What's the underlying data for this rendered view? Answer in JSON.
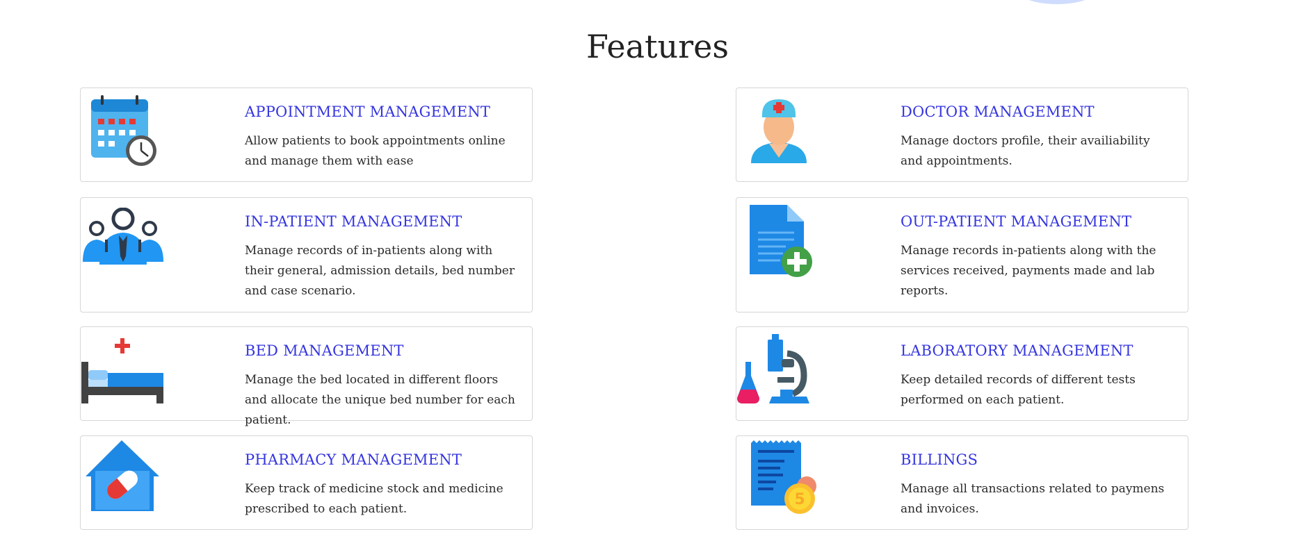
{
  "page": {
    "title": "Features"
  },
  "features": [
    {
      "heading": "APPOINTMENT MANAGEMENT",
      "desc": "Allow patients to book appointments online and manage them with ease",
      "icon": "calendar-clock-icon"
    },
    {
      "heading": "DOCTOR MANAGEMENT",
      "desc": "Manage doctors profile, their availiability and appointments.",
      "icon": "doctor-icon"
    },
    {
      "heading": "IN-PATIENT MANAGEMENT",
      "desc": "Manage records of in-patients along with their general, admission details, bed number and case scenario.",
      "icon": "people-group-icon"
    },
    {
      "heading": "OUT-PATIENT MANAGEMENT",
      "desc": "Manage records in-patients along with the services received, payments made and lab reports.",
      "icon": "medical-document-icon"
    },
    {
      "heading": "BED MANAGEMENT",
      "desc": "Manage the bed located in different floors and allocate the unique bed number for each patient.",
      "icon": "hospital-bed-icon"
    },
    {
      "heading": "LABORATORY MANAGEMENT",
      "desc": "Keep detailed records of different tests performed on each patient.",
      "icon": "microscope-icon"
    },
    {
      "heading": "PHARMACY MANAGEMENT",
      "desc": "Keep track of medicine stock and medicine prescribed to each patient.",
      "icon": "pharmacy-pill-icon"
    },
    {
      "heading": "BILLINGS",
      "desc": "Manage all transactions related to paymens and invoices.",
      "icon": "bill-receipt-icon"
    }
  ],
  "colors": {
    "heading": "#3535e0",
    "border": "#d6d6d6",
    "accent_blue": "#1e90ff"
  }
}
